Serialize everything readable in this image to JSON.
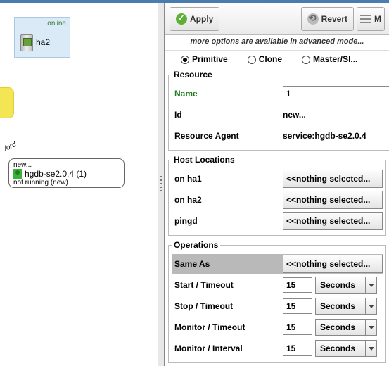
{
  "left": {
    "host": {
      "status": "online",
      "name": "ha2"
    },
    "ord_text": "/ord",
    "service": {
      "new_label": "new...",
      "name": "hgdb-se2.0.4 (1)",
      "status": "not running (new)"
    }
  },
  "toolbar": {
    "apply": "Apply",
    "revert": "Revert",
    "menu_abbrev": "M"
  },
  "more_options": "more options are available in advanced mode...",
  "type_radios": {
    "primitive": "Primitive",
    "clone": "Clone",
    "master": "Master/Sl..."
  },
  "resource": {
    "legend": "Resource",
    "name_label": "Name",
    "name_value": "1",
    "id_label": "Id",
    "id_value": "new...",
    "agent_label": "Resource Agent",
    "agent_value": "service:hgdb-se2.0.4"
  },
  "host_locations": {
    "legend": "Host Locations",
    "rows": [
      {
        "label": "on ha1",
        "value": "<<nothing selected..."
      },
      {
        "label": "on ha2",
        "value": "<<nothing selected..."
      },
      {
        "label": "pingd",
        "value": "<<nothing selected..."
      }
    ]
  },
  "operations": {
    "legend": "Operations",
    "same_as_label": "Same As",
    "same_as_value": "<<nothing selected...",
    "rows": [
      {
        "label": "Start / Timeout",
        "value": "15",
        "unit": "Seconds"
      },
      {
        "label": "Stop / Timeout",
        "value": "15",
        "unit": "Seconds"
      },
      {
        "label": "Monitor / Timeout",
        "value": "15",
        "unit": "Seconds"
      },
      {
        "label": "Monitor / Interval",
        "value": "15",
        "unit": "Seconds"
      }
    ]
  }
}
